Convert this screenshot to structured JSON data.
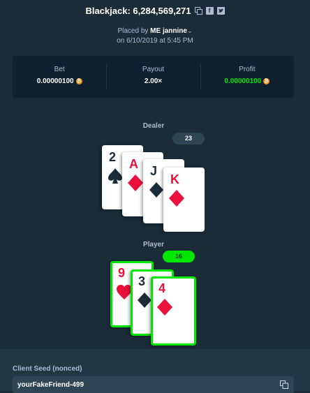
{
  "header": {
    "title": "Blackjack: 6,284,569,271",
    "placed_prefix": "Placed by",
    "user": "ME jannine",
    "datetime": "on 6/10/2019 at 5:45 PM"
  },
  "stats": {
    "bet_label": "Bet",
    "bet_value": "0.00000100",
    "payout_label": "Payout",
    "payout_value": "2.00×",
    "profit_label": "Profit",
    "profit_value": "0.00000100",
    "currency_icon": "bitcoin-icon",
    "profit_color": "#00e701"
  },
  "dealer": {
    "label": "Dealer",
    "total": "23",
    "cards": [
      {
        "rank": "2",
        "suit": "spade"
      },
      {
        "rank": "A",
        "suit": "diamond"
      },
      {
        "rank": "J",
        "suit": "club"
      },
      {
        "rank": "K",
        "suit": "diamond"
      }
    ]
  },
  "player": {
    "label": "Player",
    "total": "16",
    "cards": [
      {
        "rank": "9",
        "suit": "heart"
      },
      {
        "rank": "3",
        "suit": "club"
      },
      {
        "rank": "4",
        "suit": "diamond"
      }
    ]
  },
  "seed": {
    "label": "Client Seed (nonced)",
    "value": "yourFakeFriend-499"
  },
  "colors": {
    "background": "#1a2c38",
    "panel": "#0f212e",
    "win": "#00e701",
    "red_suit": "#e9113c",
    "black_suit": "#1a2c38"
  }
}
